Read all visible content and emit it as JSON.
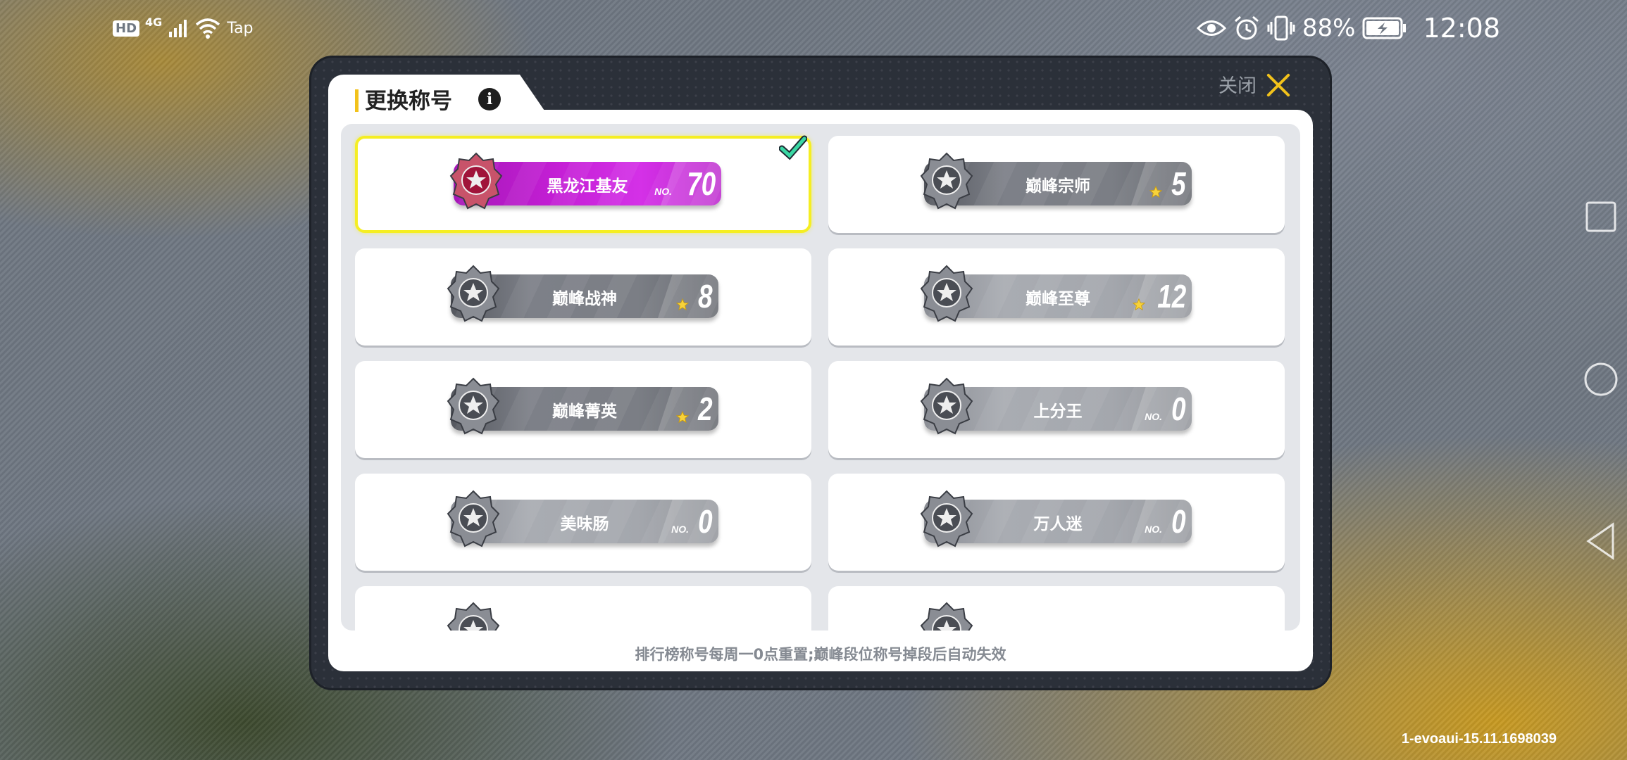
{
  "status_bar": {
    "hd": "HD",
    "network": "4G",
    "tap": "Tap",
    "battery_percent": "88%",
    "time": "12:08"
  },
  "dialog": {
    "title": "更换称号",
    "close_label": "关闭",
    "footer_note": "排行榜称号每周一0点重置;巅峰段位称号掉段后自动失效"
  },
  "titles": [
    {
      "name": "黑龙江基友",
      "prefix": "NO.",
      "value": "70",
      "style": "gold",
      "selected": true
    },
    {
      "name": "巅峰宗师",
      "prefix": "star",
      "value": "5",
      "style": "dark",
      "selected": false
    },
    {
      "name": "巅峰战神",
      "prefix": "star",
      "value": "8",
      "style": "dark",
      "selected": false
    },
    {
      "name": "巅峰至尊",
      "prefix": "star",
      "value": "12",
      "style": "light",
      "selected": false
    },
    {
      "name": "巅峰菁英",
      "prefix": "star",
      "value": "2",
      "style": "dark",
      "selected": false
    },
    {
      "name": "上分王",
      "prefix": "NO.",
      "value": "0",
      "style": "light",
      "selected": false
    },
    {
      "name": "美味肠",
      "prefix": "NO.",
      "value": "0",
      "style": "light",
      "selected": false
    },
    {
      "name": "万人迷",
      "prefix": "NO.",
      "value": "0",
      "style": "light",
      "selected": false
    }
  ],
  "build_id": "1-evoaui-15.11.1698039",
  "colors": {
    "accent": "#f2c21b",
    "selected_border": "#f5ee22",
    "gold_plate": "#c51fd6"
  }
}
